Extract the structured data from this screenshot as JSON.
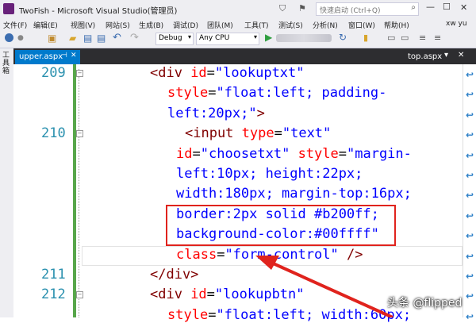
{
  "titlebar": {
    "title": "TwoFish - Microsoft Visual Studio(管理员)",
    "search_placeholder": "快速启动 (Ctrl+Q)",
    "minimize": "—",
    "maximize": "☐",
    "close": "✕"
  },
  "menu": {
    "items": [
      "文件(F)",
      "编辑(E)",
      "视图(V)",
      "网站(S)",
      "生成(B)",
      "调试(D)",
      "团队(M)",
      "工具(T)",
      "测试(S)",
      "分析(N)",
      "窗口(W)",
      "帮助(H)"
    ],
    "user": "xw yu"
  },
  "toolbar": {
    "config": "Debug",
    "platform": "Any CPU"
  },
  "tabs": {
    "left_tab": "upper.aspx",
    "right_tab": "top.aspx",
    "side_label": "工具箱"
  },
  "editor": {
    "lines": [
      {
        "num": "209",
        "parts": [
          [
            "tag",
            "<div "
          ],
          [
            "attr",
            "id"
          ],
          [
            "txt",
            "="
          ],
          [
            "val",
            "\"lookuptxt\""
          ]
        ]
      },
      {
        "num": "",
        "parts": [
          [
            "attr",
            "style"
          ],
          [
            "txt",
            "="
          ],
          [
            "val",
            "\"float:left; padding-"
          ]
        ]
      },
      {
        "num": "",
        "parts": [
          [
            "val",
            "left:20px;\""
          ],
          [
            "tag",
            ">"
          ]
        ]
      },
      {
        "num": "210",
        "parts": [
          [
            "tag",
            "<input "
          ],
          [
            "attr",
            "type"
          ],
          [
            "txt",
            "="
          ],
          [
            "val",
            "\"text\""
          ]
        ]
      },
      {
        "num": "",
        "parts": [
          [
            "attr",
            "id"
          ],
          [
            "txt",
            "="
          ],
          [
            "val",
            "\"choosetxt\" "
          ],
          [
            "attr",
            "style"
          ],
          [
            "txt",
            "="
          ],
          [
            "val",
            "\"margin-"
          ]
        ]
      },
      {
        "num": "",
        "parts": [
          [
            "val",
            "left:10px; height:22px;"
          ]
        ]
      },
      {
        "num": "",
        "parts": [
          [
            "val",
            "width:180px; margin-top:16px;"
          ]
        ]
      },
      {
        "num": "",
        "parts": [
          [
            "val",
            "border:2px solid #b200ff;"
          ]
        ]
      },
      {
        "num": "",
        "parts": [
          [
            "val",
            "background-color:#00ffff\""
          ]
        ]
      },
      {
        "num": "",
        "parts": [
          [
            "attr",
            "class"
          ],
          [
            "txt",
            "="
          ],
          [
            "val",
            "\"form-control\" "
          ],
          [
            "tag",
            "/>"
          ]
        ]
      },
      {
        "num": "211",
        "parts": [
          [
            "tag",
            "</div>"
          ]
        ]
      },
      {
        "num": "212",
        "parts": [
          [
            "tag",
            "<div "
          ],
          [
            "attr",
            "id"
          ],
          [
            "txt",
            "="
          ],
          [
            "val",
            "\"lookupbtn\""
          ]
        ]
      },
      {
        "num": "",
        "parts": [
          [
            "attr",
            "style"
          ],
          [
            "txt",
            "="
          ],
          [
            "val",
            "\"float:left; width:60px;"
          ]
        ]
      }
    ]
  },
  "watermark": "头条 @flipped",
  "colors": {
    "accent": "#e0231d",
    "chrome_bg": "#eeeef2",
    "tab_bg": "#2d2d30",
    "line_number": "#2b91af",
    "change_bar": "#57a64a"
  }
}
